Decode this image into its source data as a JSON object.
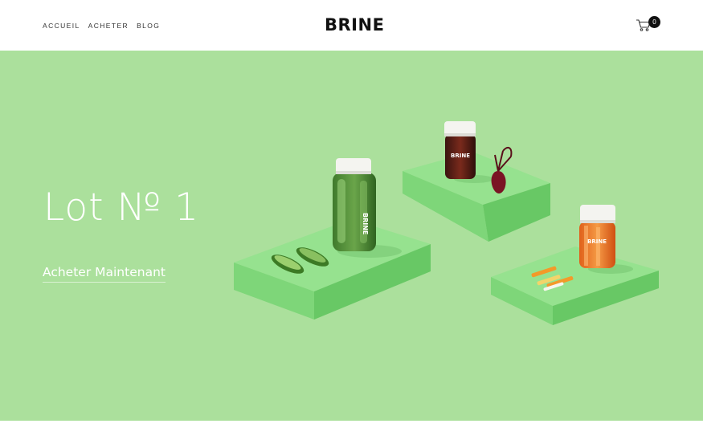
{
  "nav": {
    "items": [
      {
        "label": "ACCUEIL"
      },
      {
        "label": "ACHETER"
      },
      {
        "label": "BLOG"
      }
    ]
  },
  "brand": {
    "logo_text": "BRINE"
  },
  "cart": {
    "count": "0",
    "icon": "cart-icon"
  },
  "hero": {
    "title": "Lot № 1",
    "cta_label": "Acheter Maintenant",
    "background": "#abe09c"
  },
  "products": {
    "jar_label": "BRINE"
  },
  "colors": {
    "hero_bg": "#abe09c",
    "pedestal_top": "#94e08e",
    "pedestal_side": "#6fcf6c",
    "text_dark": "#111111",
    "white": "#ffffff"
  }
}
